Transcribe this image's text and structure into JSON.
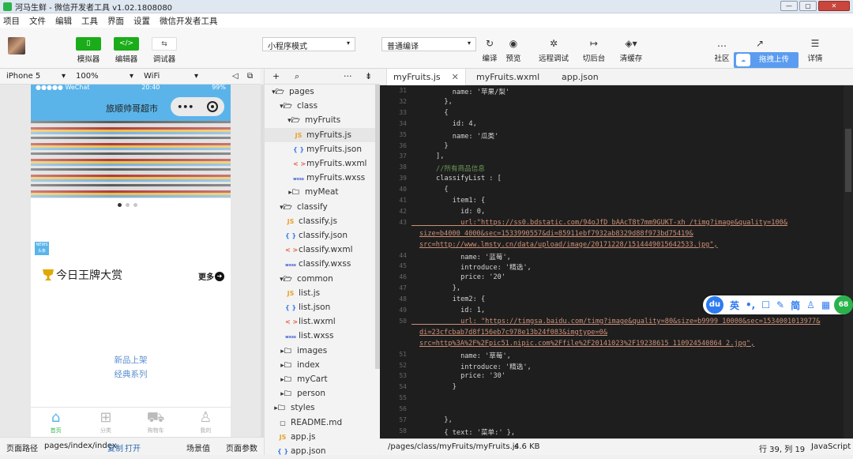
{
  "window": {
    "title": "河马生鲜 - 微信开发者工具 v1.02.1808080"
  },
  "menu": [
    "项目",
    "文件",
    "编辑",
    "工具",
    "界面",
    "设置",
    "微信开发者工具"
  ],
  "toolbar": {
    "simulator": "模拟器",
    "editor": "编辑器",
    "debugger": "调试器",
    "mode": "小程序模式",
    "compile_mode": "普通编译",
    "compile": "编译",
    "preview": "预览",
    "remote_debug": "远程调试",
    "background": "切后台",
    "clear_cache": "清缓存",
    "community": "社区",
    "upload": "拖拽上传",
    "details": "详情"
  },
  "sim": {
    "device": "iPhone 5",
    "zoom": "100%",
    "network": "WiFi",
    "status_carrier": "●●●●● WeChat",
    "status_time": "20:40",
    "status_battery": "99%",
    "page_title": "旅顺帅哥超市",
    "capsule_dots": "•••",
    "news_label": "NEWS 头条",
    "section_title": "今日王牌大赏",
    "more": "更多",
    "link_new": "新品上架",
    "link_classic": "经典系列",
    "tabs": [
      "首页",
      "分类",
      "购物车",
      "我的"
    ]
  },
  "left_footer": {
    "path_label": "页面路径",
    "path": "pages/index/index",
    "copy": "复制",
    "open": "打开",
    "scene": "场景值",
    "params": "页面参数"
  },
  "tree": {
    "items": [
      {
        "label": "pages",
        "type": "folder-open"
      },
      {
        "label": "class",
        "type": "folder-open"
      },
      {
        "label": "myFruits",
        "type": "folder-open"
      },
      {
        "label": "myFruits.js",
        "type": "js"
      },
      {
        "label": "myFruits.json",
        "type": "json"
      },
      {
        "label": "myFruits.wxml",
        "type": "wxml"
      },
      {
        "label": "myFruits.wxss",
        "type": "wxss"
      },
      {
        "label": "myMeat",
        "type": "folder"
      },
      {
        "label": "classify",
        "type": "folder-open"
      },
      {
        "label": "classify.js",
        "type": "js"
      },
      {
        "label": "classify.json",
        "type": "json"
      },
      {
        "label": "classify.wxml",
        "type": "wxml"
      },
      {
        "label": "classify.wxss",
        "type": "wxss"
      },
      {
        "label": "common",
        "type": "folder-open"
      },
      {
        "label": "list.js",
        "type": "js"
      },
      {
        "label": "list.json",
        "type": "json"
      },
      {
        "label": "list.wxml",
        "type": "wxml"
      },
      {
        "label": "list.wxss",
        "type": "wxss"
      },
      {
        "label": "images",
        "type": "folder"
      },
      {
        "label": "index",
        "type": "folder"
      },
      {
        "label": "myCart",
        "type": "folder"
      },
      {
        "label": "person",
        "type": "folder"
      },
      {
        "label": "styles",
        "type": "folder"
      },
      {
        "label": "README.md",
        "type": "md"
      },
      {
        "label": "app.js",
        "type": "js"
      },
      {
        "label": "app.json",
        "type": "json"
      }
    ]
  },
  "editor": {
    "tabs": [
      "myFruits.js",
      "myFruits.wxml",
      "app.json"
    ],
    "line_numbers": [
      "31",
      "32",
      "33",
      "34",
      "35",
      "36",
      "37",
      "38",
      "39",
      "40",
      "41",
      "42",
      "43",
      "",
      "",
      "44",
      "45",
      "46",
      "47",
      "48",
      "49",
      "50",
      "",
      "",
      "51",
      "52",
      "53",
      "54",
      "55",
      "56",
      "57",
      "58"
    ],
    "lines": [
      "          name: '苹果/梨'",
      "        },",
      "        {",
      "          id: 4,",
      "          name: '瓜类'",
      "        }",
      "      ],",
      "      //所有商品信息",
      "      classifyList : [",
      "        {",
      "          item1: {",
      "            id: 0,",
      "            url:\"https://ss0.bdstatic.com/94oJfD_bAAcT8t7mm9GUKT-xh_/timg?image&quality=100&",
      "size=b4000_4000&sec=1533990557&di=85911ebf7932ab8329d88f973bd75419&",
      "src=http://www.lmsty.cn/data/upload/image/20171228/1514449015642533.jpg\",",
      "            name: '蓝莓',",
      "            introduce: '精选',",
      "            price: '20'",
      "          },",
      "          item2: {",
      "            id: 1,",
      "            url: \"https://timgsa.baidu.com/timg?image&quality=80&size=b9999_10000&sec=1534001013977&",
      "di=23cfcbab7d8f156eb7c978e13b24f083&imgtype=0&",
      "src=http%3A%2F%2Fpic51.nipic.com%2Ffile%2F20141023%2F19238615_110924540864_2.jpg\",",
      "            name: '草莓',",
      "            introduce: '精选',",
      "            price: '30'",
      "          }",
      "",
      "",
      "        },",
      "        { text: '菜单:' },"
    ],
    "status_path": "/pages/class/myFruits/myFruits.js",
    "status_size": "4.6 KB",
    "status_pos": "行 39, 列 19",
    "status_lang": "JavaScript"
  },
  "ime": {
    "logo": "du",
    "items": [
      "英",
      "•,",
      "☐",
      "✎",
      "简",
      "♙",
      "▦"
    ],
    "badge": "68"
  }
}
